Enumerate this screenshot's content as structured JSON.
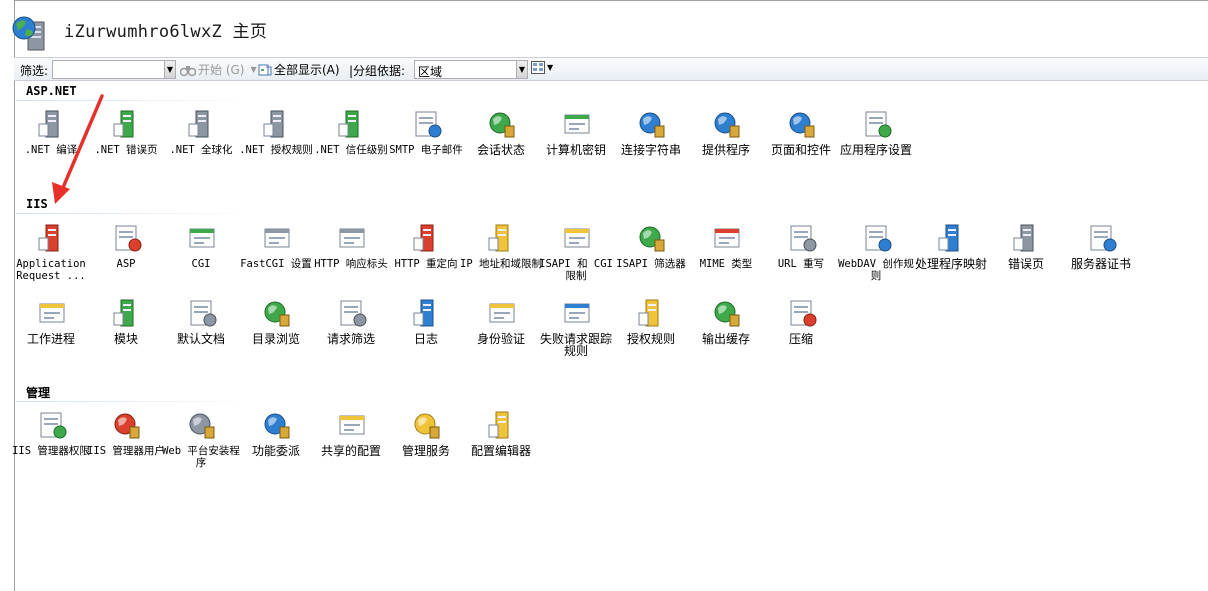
{
  "header": {
    "title": "iZurwumhro6lwxZ 主页"
  },
  "toolbar": {
    "filter_label": "筛选:",
    "filter_value": "",
    "start_label": "开始 (G)",
    "show_all_label": "全部显示(A)",
    "group_by_label": "|分组依据:",
    "group_by_value": "区域"
  },
  "sections": {
    "aspnet": {
      "title": "ASP.NET",
      "items": [
        {
          "label": ".NET 编译",
          "icon": "net-compile-icon"
        },
        {
          "label": ".NET 错误页",
          "icon": "net-error-pages-icon"
        },
        {
          "label": ".NET 全球化",
          "icon": "net-globalization-icon"
        },
        {
          "label": ".NET 授权规则",
          "icon": "net-authorization-icon"
        },
        {
          "label": ".NET 信任级别",
          "icon": "net-trust-levels-icon"
        },
        {
          "label": "SMTP 电子邮件",
          "icon": "smtp-email-icon"
        },
        {
          "label": "会话状态",
          "icon": "session-state-icon"
        },
        {
          "label": "计算机密钥",
          "icon": "machine-key-icon"
        },
        {
          "label": "连接字符串",
          "icon": "connection-strings-icon"
        },
        {
          "label": "提供程序",
          "icon": "providers-icon"
        },
        {
          "label": "页面和控件",
          "icon": "pages-controls-icon"
        },
        {
          "label": "应用程序设置",
          "icon": "app-settings-icon"
        }
      ]
    },
    "iis": {
      "title": "IIS",
      "items": [
        {
          "label": "Application Request ...",
          "icon": "application-request-routing-icon"
        },
        {
          "label": "ASP",
          "icon": "asp-icon"
        },
        {
          "label": "CGI",
          "icon": "cgi-icon"
        },
        {
          "label": "FastCGI 设置",
          "icon": "fastcgi-icon"
        },
        {
          "label": "HTTP 响应标头",
          "icon": "http-response-headers-icon"
        },
        {
          "label": "HTTP 重定向",
          "icon": "http-redirect-icon"
        },
        {
          "label": "IP 地址和域限制",
          "icon": "ip-domain-restrictions-icon"
        },
        {
          "label": "ISAPI 和 CGI 限制",
          "icon": "isapi-cgi-restrictions-icon"
        },
        {
          "label": "ISAPI 筛选器",
          "icon": "isapi-filters-icon"
        },
        {
          "label": "MIME 类型",
          "icon": "mime-types-icon"
        },
        {
          "label": "URL 重写",
          "icon": "url-rewrite-icon"
        },
        {
          "label": "WebDAV 创作规则",
          "icon": "webdav-icon"
        },
        {
          "label": "处理程序映射",
          "icon": "handler-mappings-icon"
        },
        {
          "label": "错误页",
          "icon": "error-pages-icon"
        },
        {
          "label": "服务器证书",
          "icon": "server-certificates-icon"
        },
        {
          "label": "工作进程",
          "icon": "worker-processes-icon"
        },
        {
          "label": "模块",
          "icon": "modules-icon"
        },
        {
          "label": "默认文档",
          "icon": "default-document-icon"
        },
        {
          "label": "目录浏览",
          "icon": "directory-browsing-icon"
        },
        {
          "label": "请求筛选",
          "icon": "request-filtering-icon"
        },
        {
          "label": "日志",
          "icon": "logging-icon"
        },
        {
          "label": "身份验证",
          "icon": "authentication-icon"
        },
        {
          "label": "失败请求跟踪规则",
          "icon": "failed-request-tracing-icon"
        },
        {
          "label": "授权规则",
          "icon": "authorization-rules-icon"
        },
        {
          "label": "输出缓存",
          "icon": "output-caching-icon"
        },
        {
          "label": "压缩",
          "icon": "compression-icon"
        }
      ]
    },
    "management": {
      "title": "管理",
      "items": [
        {
          "label": "IIS 管理器权限",
          "icon": "iis-manager-permissions-icon"
        },
        {
          "label": "IIS 管理器用户",
          "icon": "iis-manager-users-icon"
        },
        {
          "label": "Web 平台安装程序",
          "icon": "web-platform-installer-icon"
        },
        {
          "label": "功能委派",
          "icon": "feature-delegation-icon"
        },
        {
          "label": "共享的配置",
          "icon": "shared-configuration-icon"
        },
        {
          "label": "管理服务",
          "icon": "management-service-icon"
        },
        {
          "label": "配置编辑器",
          "icon": "configuration-editor-icon"
        }
      ]
    }
  },
  "colors": {
    "annotation_arrow": "#e8302a",
    "toolbar_border": "#c8cfd8"
  }
}
